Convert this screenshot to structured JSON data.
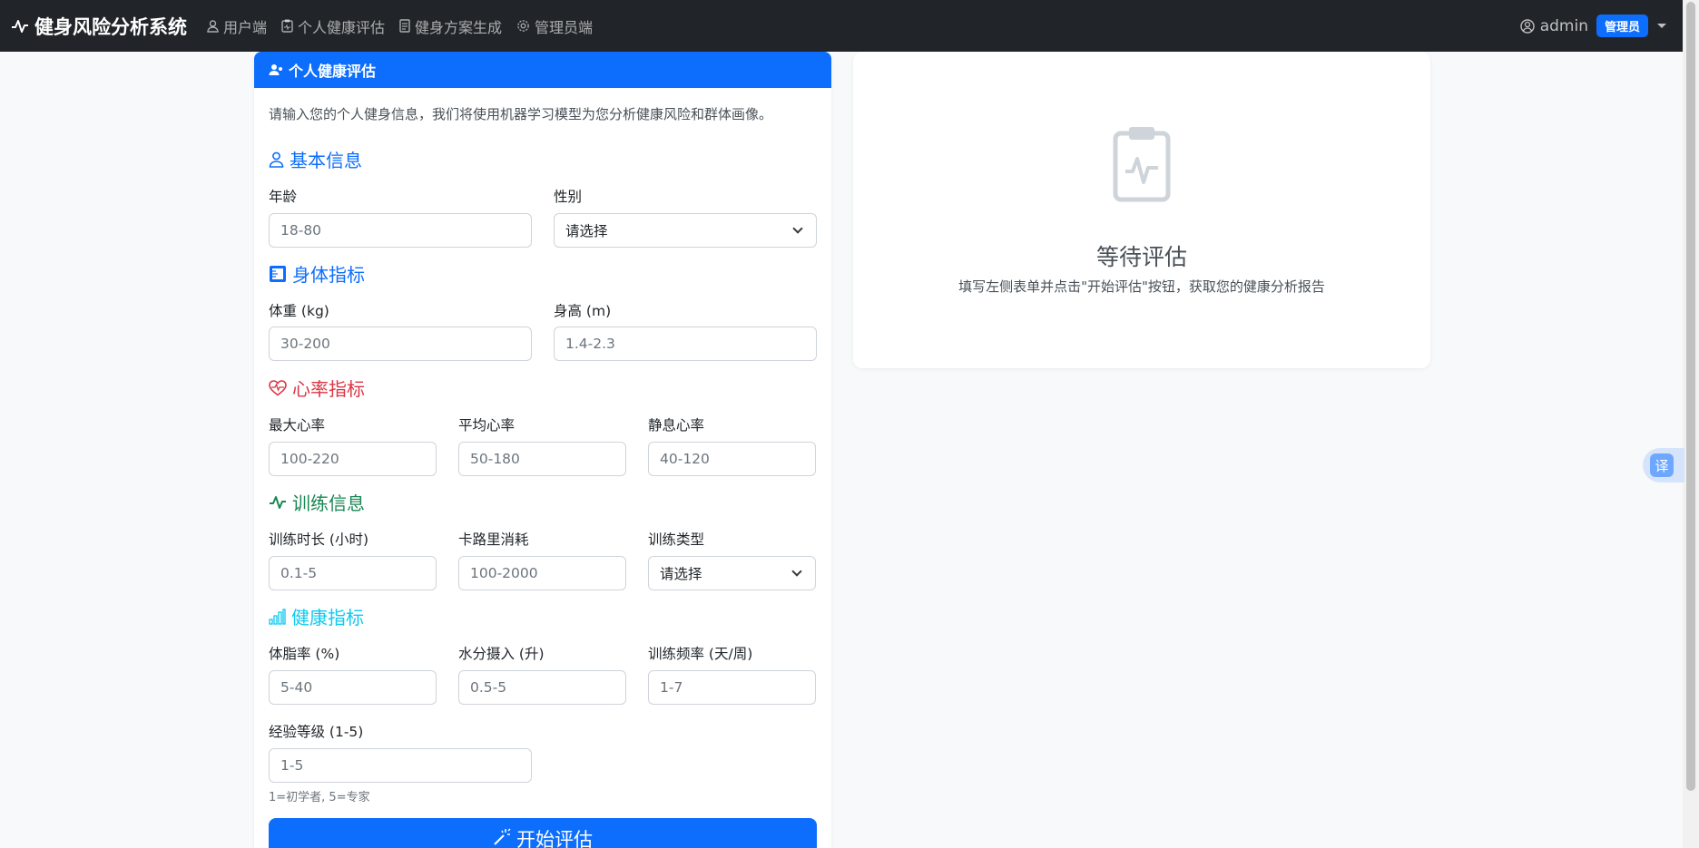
{
  "navbar": {
    "brand": "健身风险分析系统",
    "items": [
      {
        "label": "用户端",
        "icon": "person-icon"
      },
      {
        "label": "个人健康评估",
        "icon": "clipboard-pulse-icon"
      },
      {
        "label": "健身方案生成",
        "icon": "document-icon"
      },
      {
        "label": "管理员端",
        "icon": "gear-icon"
      }
    ],
    "username": "admin",
    "role_badge": "管理员"
  },
  "form": {
    "header": "个人健康评估",
    "intro": "请输入您的个人健身信息，我们将使用机器学习模型为您分析健康风险和群体画像。",
    "sections": {
      "basic": "基本信息",
      "body": "身体指标",
      "heart": "心率指标",
      "training": "训练信息",
      "health": "健康指标"
    },
    "fields": {
      "age": {
        "label": "年龄",
        "placeholder": "18-80"
      },
      "gender": {
        "label": "性别",
        "value": "请选择"
      },
      "weight": {
        "label": "体重 (kg)",
        "placeholder": "30-200"
      },
      "height": {
        "label": "身高 (m)",
        "placeholder": "1.4-2.3"
      },
      "max_hr": {
        "label": "最大心率",
        "placeholder": "100-220"
      },
      "avg_hr": {
        "label": "平均心率",
        "placeholder": "50-180"
      },
      "rest_hr": {
        "label": "静息心率",
        "placeholder": "40-120"
      },
      "duration": {
        "label": "训练时长 (小时)",
        "placeholder": "0.1-5"
      },
      "calories": {
        "label": "卡路里消耗",
        "placeholder": "100-2000"
      },
      "workout_type": {
        "label": "训练类型",
        "value": "请选择"
      },
      "fat": {
        "label": "体脂率 (%)",
        "placeholder": "5-40"
      },
      "water": {
        "label": "水分摄入 (升)",
        "placeholder": "0.5-5"
      },
      "frequency": {
        "label": "训练频率 (天/周)",
        "placeholder": "1-7"
      },
      "experience": {
        "label": "经验等级 (1-5)",
        "placeholder": "1-5",
        "hint": "1=初学者, 5=专家"
      }
    },
    "submit": "开始评估"
  },
  "result": {
    "title": "等待评估",
    "description": "填写左侧表单并点击\"开始评估\"按钮，获取您的健康分析报告"
  },
  "translate": {
    "label": "译"
  },
  "colors": {
    "navbar": "#212529",
    "primary": "#0d6efd",
    "danger": "#dc3545",
    "success": "#198754",
    "info": "#0dcaf0"
  }
}
